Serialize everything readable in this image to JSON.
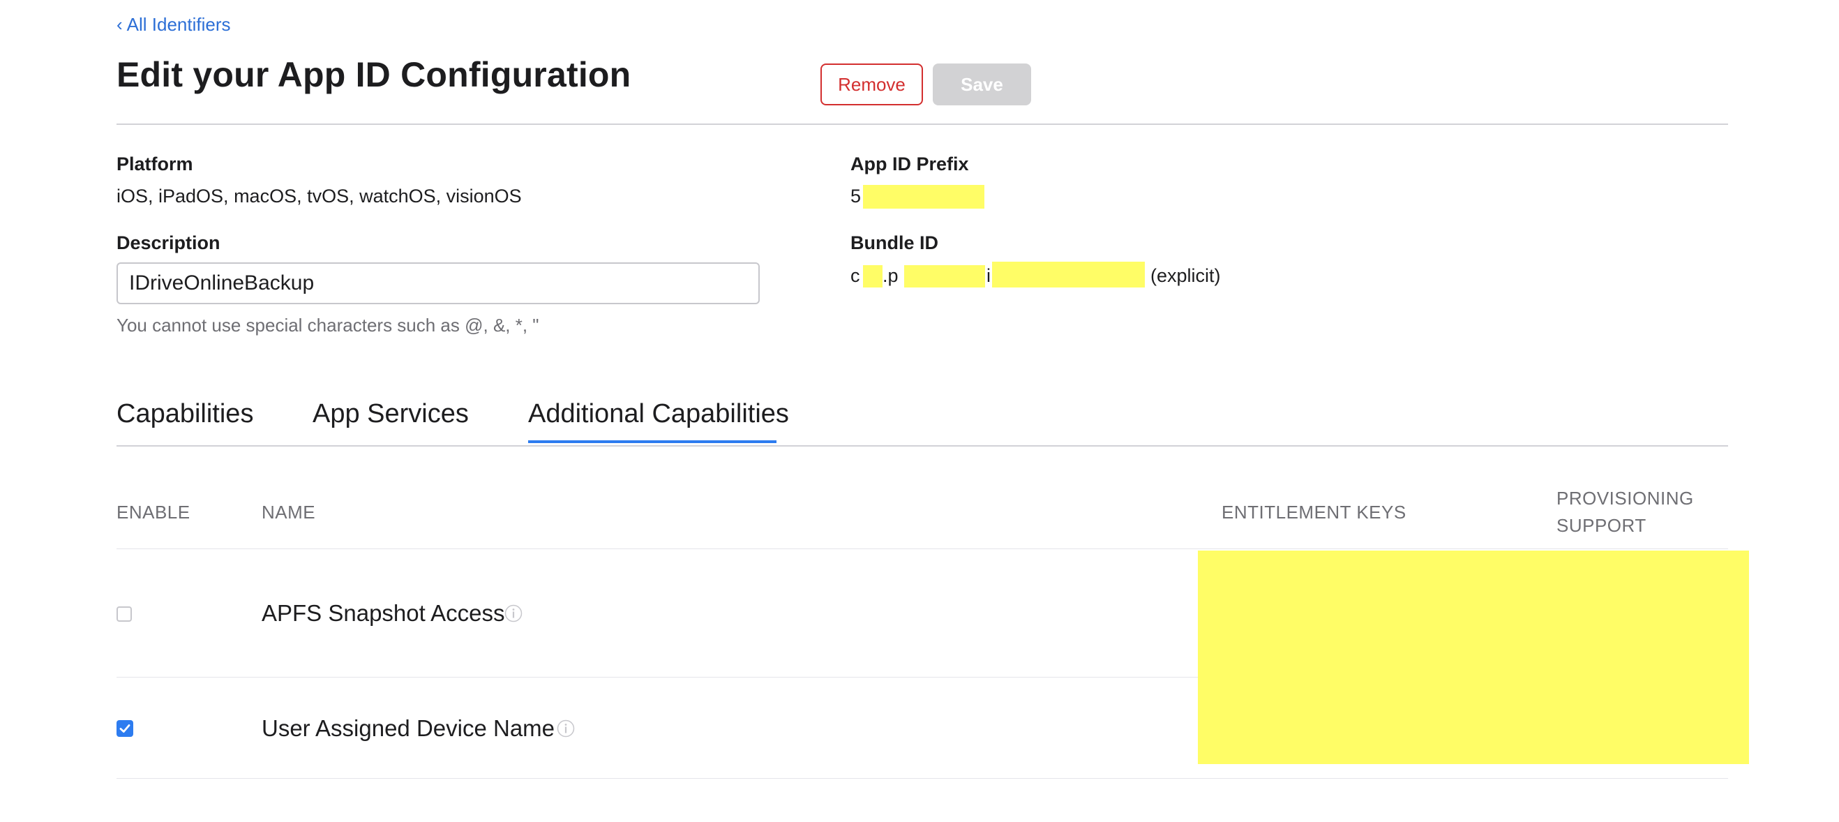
{
  "nav": {
    "back_label": "All Identifiers",
    "back_icon": "chevron-left-icon"
  },
  "header": {
    "title": "Edit your App ID Configuration",
    "remove_label": "Remove",
    "save_label": "Save"
  },
  "details": {
    "platform_label": "Platform",
    "platform_value": "iOS, iPadOS, macOS, tvOS, watchOS, visionOS",
    "prefix_label": "App ID Prefix",
    "prefix_value_visible": "5",
    "description_label": "Description",
    "description_value": "IDriveOnlineBackup",
    "description_hint": "You cannot use special characters such as @, &, *, \"",
    "bundle_label": "Bundle ID",
    "bundle_part_1": "c",
    "bundle_part_2": ".p",
    "bundle_part_3": "i",
    "bundle_suffix": "(explicit)"
  },
  "tabs": [
    {
      "label": "Capabilities",
      "active": false
    },
    {
      "label": "App Services",
      "active": false
    },
    {
      "label": "Additional Capabilities",
      "active": true
    }
  ],
  "table": {
    "headers": {
      "enable": "ENABLE",
      "name": "NAME",
      "entitlement": "ENTITLEMENT KEYS",
      "provisioning_line1": "PROVISIONING",
      "provisioning_line2": "SUPPORT"
    },
    "rows": [
      {
        "name": "APFS Snapshot Access",
        "enabled": false,
        "info_icon": "info-icon"
      },
      {
        "name": "User Assigned Device Name",
        "enabled": true,
        "info_icon": "info-icon"
      }
    ]
  },
  "colors": {
    "accent": "#2d7cf0",
    "link": "#2d6fd6",
    "danger": "#d32f2f",
    "redaction": "#fffd66"
  }
}
